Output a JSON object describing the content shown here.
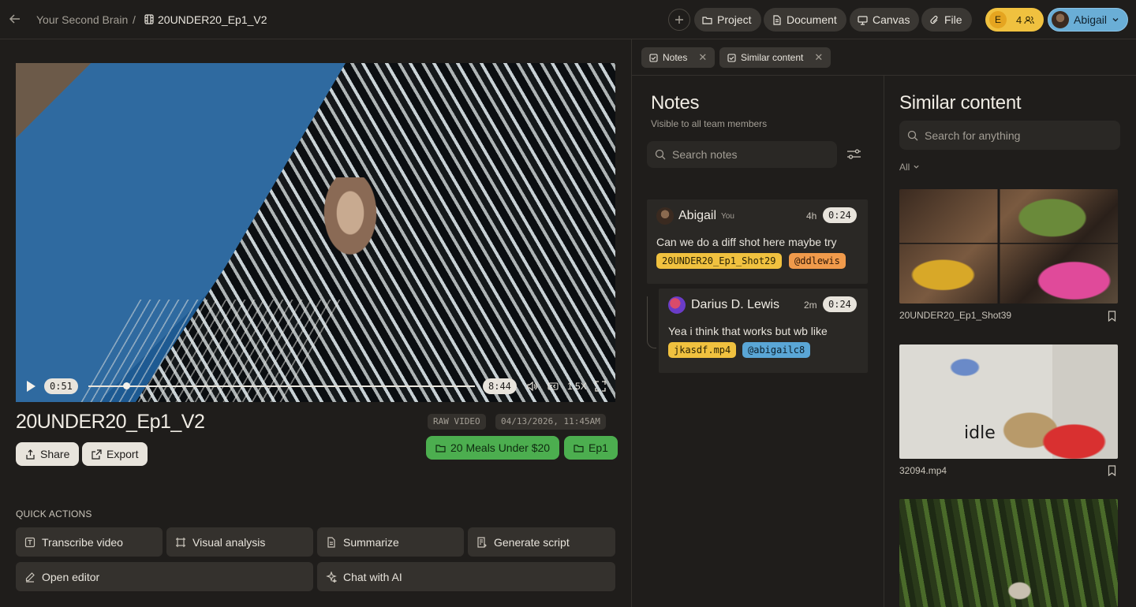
{
  "breadcrumb": {
    "root": "Your Second Brain",
    "separator": "/",
    "current": "20UNDER20_Ep1_V2"
  },
  "header": {
    "add_buttons": [
      {
        "label": "Project",
        "icon": "folder-icon"
      },
      {
        "label": "Document",
        "icon": "document-icon"
      },
      {
        "label": "Canvas",
        "icon": "canvas-icon"
      },
      {
        "label": "File",
        "icon": "paperclip-icon"
      }
    ],
    "team": {
      "initial": "E",
      "count": "4"
    },
    "user": {
      "name": "Abigail"
    },
    "colors": {
      "team": "#f0c13f",
      "user": "#6aaed6"
    }
  },
  "player": {
    "current_time": "0:51",
    "duration": "8:44",
    "speed": "1.5X",
    "progress": 0.097
  },
  "video": {
    "title": "20UNDER20_Ep1_V2",
    "type_badge": "RAW VIDEO",
    "date": "04/13/2026, 11:45AM",
    "share_label": "Share",
    "export_label": "Export",
    "folders": [
      "20 Meals Under $20",
      "Ep1"
    ],
    "folder_color": "#4cae4f"
  },
  "quick_actions": {
    "heading": "QUICK ACTIONS",
    "items": [
      {
        "label": "Transcribe video",
        "icon": "transcribe-icon"
      },
      {
        "label": "Visual analysis",
        "icon": "visual-analysis-icon"
      },
      {
        "label": "Summarize",
        "icon": "summarize-icon"
      },
      {
        "label": "Generate script",
        "icon": "script-icon"
      },
      {
        "label": "Open editor",
        "icon": "pencil-icon"
      },
      {
        "label": "Chat with AI",
        "icon": "sparkle-icon"
      }
    ]
  },
  "tabs": [
    {
      "label": "Notes"
    },
    {
      "label": "Similar content"
    }
  ],
  "notes": {
    "title": "Notes",
    "subtitle": "Visible to all team members",
    "search_placeholder": "Search notes",
    "items": [
      {
        "author": "Abigail",
        "you_label": "You",
        "age": "4h",
        "timestamp": "0:24",
        "text": "Can we do a diff shot here maybe try",
        "tags": [
          "20UNDER20_Ep1_Shot29",
          "@ddlewis"
        ]
      },
      {
        "author": "Darius D. Lewis",
        "age": "2m",
        "timestamp": "0:24",
        "text": "Yea i think that works but wb like",
        "tags": [
          "jkasdf.mp4",
          "@abigailc8"
        ]
      }
    ]
  },
  "similar": {
    "title": "Similar content",
    "search_placeholder": "Search for anything",
    "filter": "All",
    "items": [
      {
        "name": "20UNDER20_Ep1_Shot39"
      },
      {
        "name": "32094.mp4",
        "sign_text": "idle"
      },
      {
        "name": ""
      }
    ]
  }
}
